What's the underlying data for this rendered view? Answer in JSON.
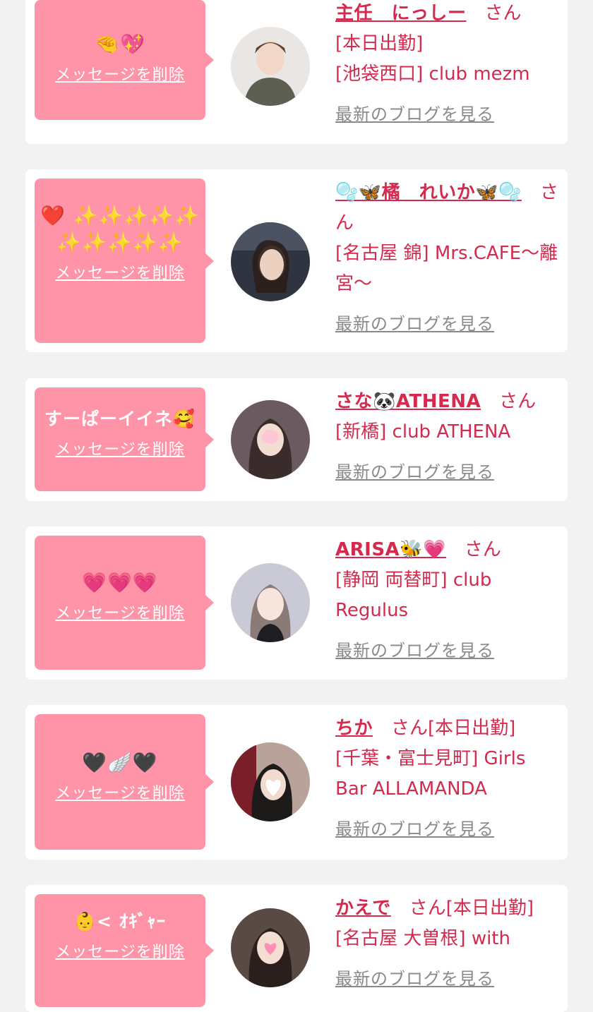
{
  "delete_label": "メッセージを削除",
  "san_label": "さん",
  "blog_label": "最新のブログを見る",
  "theme": {
    "background": "#f2f2f2",
    "card": "#ffffff",
    "bubble": "#ff94a8",
    "accent": "#d42a4e",
    "muted": "#8a8a8a"
  },
  "items": [
    {
      "stamp": "🤏💖",
      "name": "主任　にっしー",
      "status": "[本日出勤]",
      "shop": "[池袋西口] club mezm",
      "avatar_icon": "avatar-photo"
    },
    {
      "stamp": "❤️ ✨✨✨✨✨✨✨✨✨✨",
      "name": "🫧🦋橘　れいか🦋🫧",
      "status": "",
      "shop": "[名古屋 錦] Mrs.CAFE〜離宮〜",
      "avatar_icon": "avatar-photo"
    },
    {
      "stamp": "すーぱーイイネ🥰",
      "name": "さな🐼ATHENA",
      "status": "",
      "shop": "[新橋] club ATHENA",
      "avatar_icon": "avatar-photo"
    },
    {
      "stamp": "💗💗💗",
      "name": "ARISA🐝💗",
      "status": "",
      "shop": "[静岡 両替町] club Regulus",
      "avatar_icon": "avatar-photo"
    },
    {
      "stamp": "🖤🪽🖤",
      "name": "ちか",
      "status": "[本日出勤]",
      "shop": "[千葉・富士見町] Girls Bar ALLAMANDA",
      "avatar_icon": "avatar-photo"
    },
    {
      "stamp": "👶< ｵｷﾞｬｰ",
      "name": "かえで",
      "status": "[本日出勤]",
      "shop": "[名古屋 大曽根] with",
      "avatar_icon": "avatar-photo"
    }
  ]
}
